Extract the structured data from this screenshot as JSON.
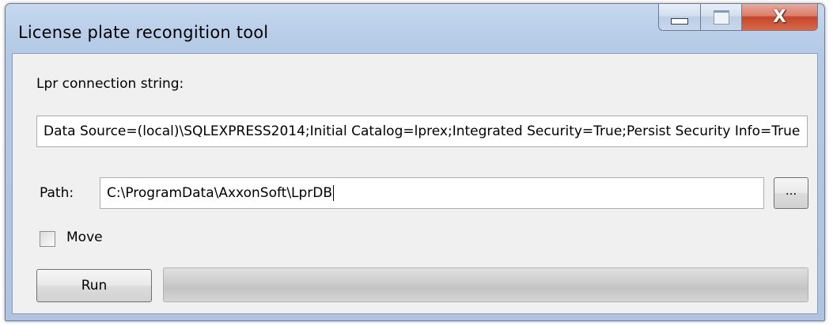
{
  "window": {
    "title": "License plate recongition tool",
    "controls": {
      "minimize_icon": "minimize-icon",
      "maximize_icon": "maximize-icon",
      "close_glyph": "X"
    }
  },
  "form": {
    "connection_label": "Lpr connection string:",
    "connection_value": "Data Source=(local)\\SQLEXPRESS2014;Initial Catalog=lprex;Integrated Security=True;Persist Security Info=True",
    "path_label": "Path:",
    "path_value": "C:\\ProgramData\\AxxonSoft\\LprDB",
    "browse_label": "...",
    "move_label": "Move",
    "move_checked": false,
    "run_label": "Run",
    "progress_percent": 0
  },
  "colors": {
    "title_bar": "#b8cde8",
    "close_button": "#c6452a",
    "client_bg": "#f0f0f0"
  }
}
